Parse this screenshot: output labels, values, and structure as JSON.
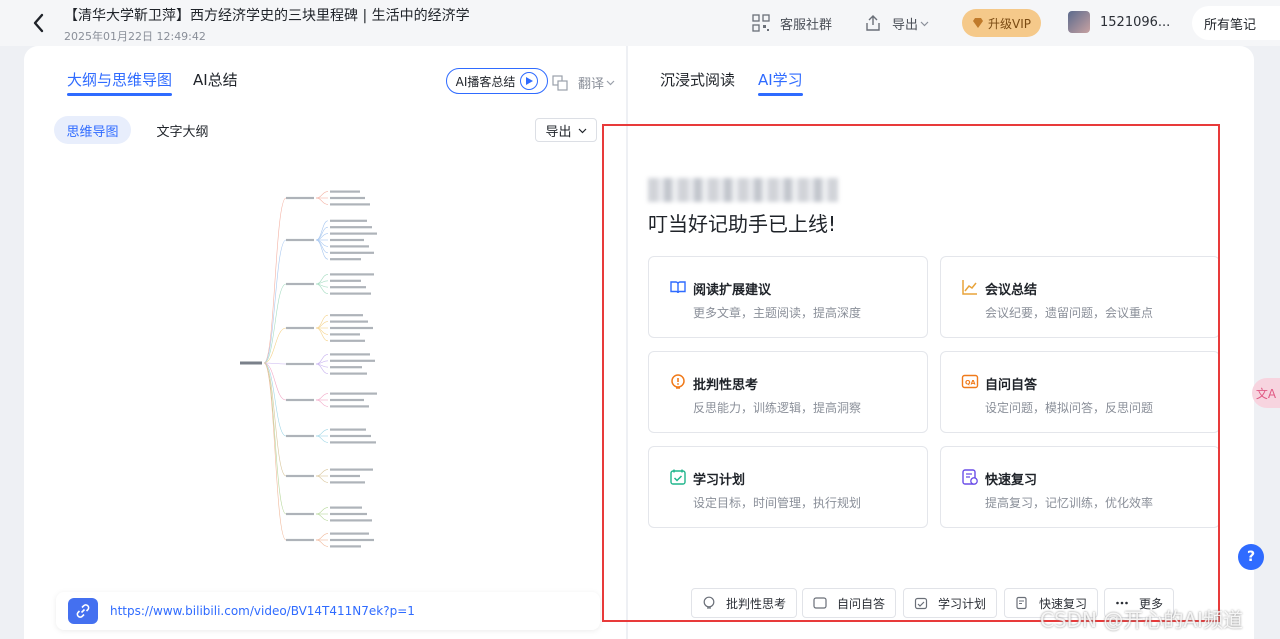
{
  "header": {
    "title": "【清华大学靳卫萍】西方经济学史的三块里程碑 | 生活中的经济学",
    "date": "2025年01月22日 12:49:42",
    "community": "客服社群",
    "export": "导出",
    "vip": "升级VIP",
    "user": "1521096...",
    "all_notes": "所有笔记"
  },
  "left": {
    "tabs": [
      "大纲与思维导图",
      "AI总结"
    ],
    "podcast": "AI播客总结",
    "translate": "翻译",
    "segments": [
      "思维导图",
      "文字大纲"
    ],
    "export": "导出",
    "url": "https://www.bilibili.com/video/BV14T411N7ek?p=1"
  },
  "right": {
    "tabs": [
      "沉浸式阅读",
      "AI学习"
    ],
    "greeting": "叮当好记助手已上线!",
    "cards": [
      {
        "title": "阅读扩展建议",
        "desc": "更多文章，主题阅读，提高深度",
        "icon": "book-icon"
      },
      {
        "title": "会议总结",
        "desc": "会议纪要，遗留问题，会议重点",
        "icon": "chart-icon"
      },
      {
        "title": "批判性思考",
        "desc": "反思能力，训练逻辑，提高洞察",
        "icon": "bulb-icon"
      },
      {
        "title": "自问自答",
        "desc": "设定问题，模拟问答，反思问题",
        "icon": "qa-icon"
      },
      {
        "title": "学习计划",
        "desc": "设定目标，时间管理，执行规划",
        "icon": "plan-icon"
      },
      {
        "title": "快速复习",
        "desc": "提高复习，记忆训练，优化效率",
        "icon": "review-icon"
      }
    ],
    "chips": [
      "批判性思考",
      "自问自答",
      "学习计划",
      "快速复习",
      "更多"
    ]
  },
  "floating": {
    "translate_badge": "文A",
    "help": "?"
  },
  "watermark": "CSDN @开心的AI频道",
  "colors": {
    "accent": "#2f6bff",
    "vip": "#f5c98a",
    "highlight": "#e83a3a"
  }
}
